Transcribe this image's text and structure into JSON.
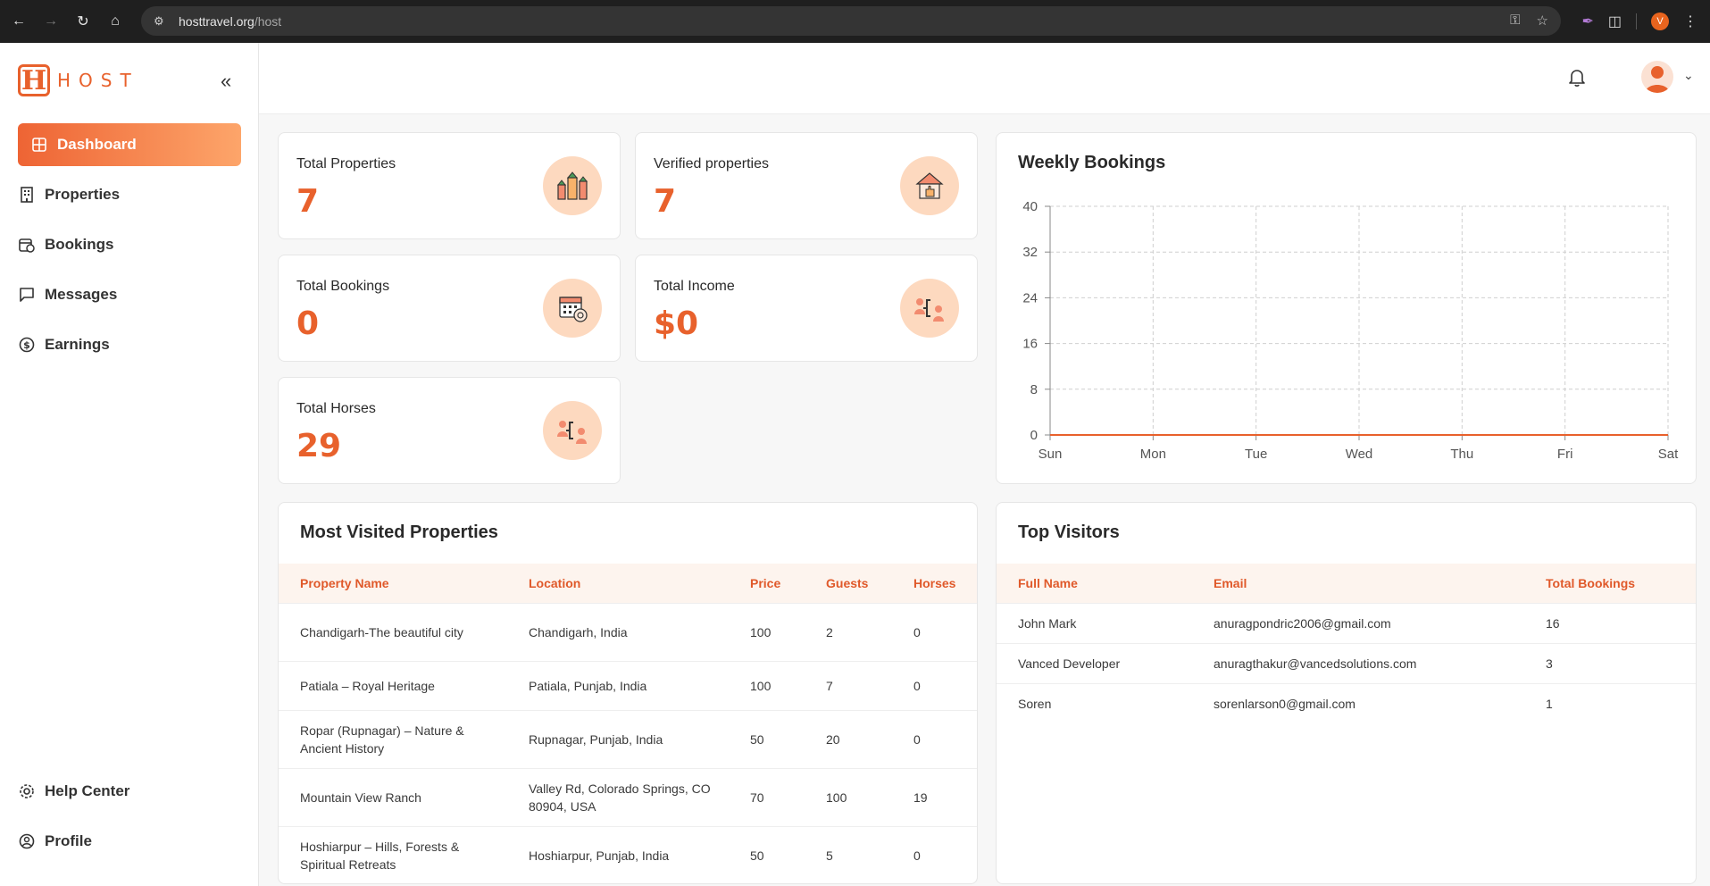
{
  "browser": {
    "url_domain": "hosttravel.org",
    "url_path": "/host",
    "profile_initial": "V"
  },
  "brand": {
    "logo_letter": "H",
    "name": "HOST",
    "accent": "#e8612c"
  },
  "sidebar": {
    "items": [
      {
        "label": "Dashboard",
        "icon": "grid-icon",
        "active": true
      },
      {
        "label": "Properties",
        "icon": "building-icon"
      },
      {
        "label": "Bookings",
        "icon": "calendar-clock-icon"
      },
      {
        "label": "Messages",
        "icon": "message-icon"
      },
      {
        "label": "Earnings",
        "icon": "dollar-circle-icon"
      }
    ],
    "bottom_items": [
      {
        "label": "Help Center",
        "icon": "gear-icon"
      },
      {
        "label": "Profile",
        "icon": "user-circle-icon"
      }
    ]
  },
  "stats": [
    {
      "label": "Total Properties",
      "value": "7",
      "icon": "buildings-icon"
    },
    {
      "label": "Verified properties",
      "value": "7",
      "icon": "verified-house-icon"
    },
    {
      "label": "Total Bookings",
      "value": "0",
      "icon": "calendar-icon"
    },
    {
      "label": "Total Income",
      "value": "$0",
      "icon": "income-icon"
    },
    {
      "label": "Total Horses",
      "value": "29",
      "icon": "horses-icon"
    }
  ],
  "chart_data": {
    "type": "line",
    "title": "Weekly Bookings",
    "categories": [
      "Sun",
      "Mon",
      "Tue",
      "Wed",
      "Thu",
      "Fri",
      "Sat"
    ],
    "series": [
      {
        "values": [
          0,
          0,
          0,
          0,
          0,
          0,
          0
        ]
      }
    ],
    "yticks": [
      "0",
      "8",
      "16",
      "24",
      "32",
      "40"
    ],
    "ylim": [
      0,
      40
    ],
    "grid": true,
    "line_color": "#e8612c"
  },
  "most_visited": {
    "title": "Most Visited Properties",
    "columns": [
      "Property Name",
      "Location",
      "Price",
      "Guests",
      "Horses"
    ],
    "rows": [
      [
        "Chandigarh-The beautiful city",
        "Chandigarh, India",
        "100",
        "2",
        "0"
      ],
      [
        "Patiala – Royal Heritage",
        "Patiala, Punjab, India",
        "100",
        "7",
        "0"
      ],
      [
        "Ropar (Rupnagar) – Nature & Ancient History",
        "Rupnagar, Punjab, India",
        "50",
        "20",
        "0"
      ],
      [
        "Mountain View Ranch",
        "Valley Rd, Colorado Springs, CO 80904, USA",
        "70",
        "100",
        "19"
      ],
      [
        "Hoshiarpur – Hills, Forests & Spiritual Retreats",
        "Hoshiarpur, Punjab, India",
        "50",
        "5",
        "0"
      ]
    ]
  },
  "top_visitors": {
    "title": "Top Visitors",
    "columns": [
      "Full Name",
      "Email",
      "Total Bookings"
    ],
    "rows": [
      [
        "John Mark",
        "anuragpondric2006@gmail.com",
        "16"
      ],
      [
        "Vanced Developer",
        "anuragthakur@vancedsolutions.com",
        "3"
      ],
      [
        "Soren",
        "sorenlarson0@gmail.com",
        "1"
      ]
    ]
  }
}
